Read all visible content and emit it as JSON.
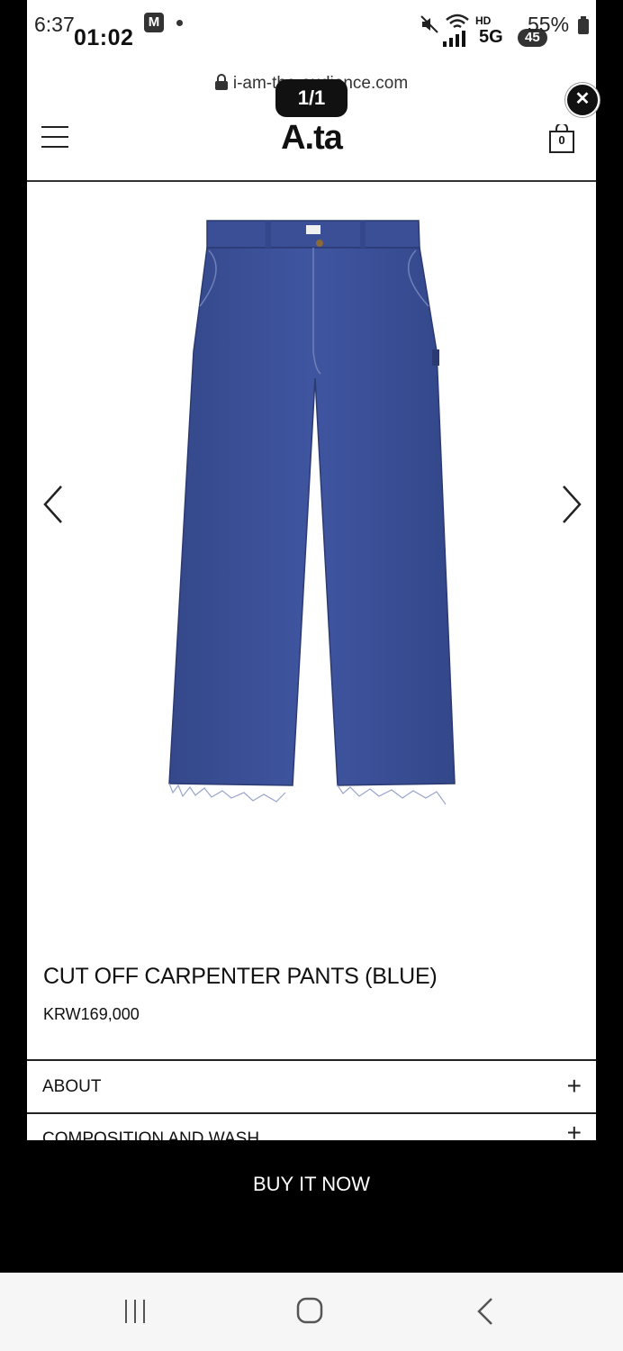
{
  "status_bar": {
    "time": "6:37",
    "overlay_time": "01:02",
    "badge": "M",
    "battery": "55%",
    "network": "5G",
    "overlay_badge": "45",
    "icons": [
      "mute-icon",
      "wifi-icon",
      "hd-voice-icon",
      "signal-icon",
      "battery-icon"
    ]
  },
  "browser": {
    "url": "i-am-the-audience.com",
    "image_counter": "1/1"
  },
  "header": {
    "logo": "A.ta",
    "cart_count": "0"
  },
  "product": {
    "title": "CUT OFF CARPENTER PANTS (BLUE)",
    "price": "KRW169,000"
  },
  "accordion": [
    {
      "label": "ABOUT",
      "icon": "+"
    },
    {
      "label": "COMPOSITION AND WASH",
      "icon": "+"
    }
  ],
  "cta": {
    "label": "BUY IT NOW"
  },
  "colors": {
    "denim": "#3a4f96",
    "background": "#ffffff",
    "bar": "#000000"
  }
}
